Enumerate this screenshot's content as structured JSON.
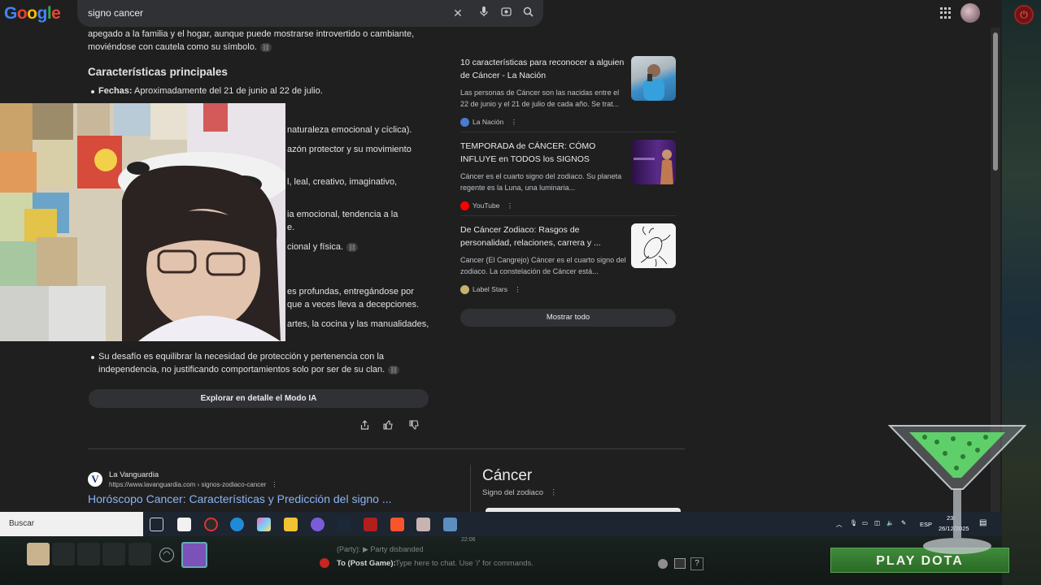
{
  "google": {
    "logo": "Google",
    "search_query": "signo cancer"
  },
  "overview": {
    "intro_line1": "apegado a la familia y el hogar, aunque puede mostrarse introvertido o cambiante,",
    "intro_line2": "moviéndose con cautela como su símbolo.",
    "heading": "Características principales",
    "fechas_label": "Fechas:",
    "fechas_value": "Aproximadamente del 21 de junio al 22 de julio.",
    "frag1": "naturaleza emocional y cíclica).",
    "frag2": "azón protector y su movimiento",
    "frag3": "l, leal, creativo, imaginativo,",
    "frag4": "ia emocional, tendencia a la",
    "frag4b": "e.",
    "frag5": "cional y física.",
    "frag6": "es profundas, entregándose por",
    "frag7": "que a veces lleva a decepciones.",
    "frag8": "artes, la cocina y las manualidades,",
    "last_bullet_line1": "Su desafío es equilibrar la necesidad de protección y pertenencia con la",
    "last_bullet_line2": "independencia, no justificando comportamientos solo por ser de su clan.",
    "ai_mode_button": "Explorar en detalle el Modo IA"
  },
  "sources": [
    {
      "title": "10 características para reconocer a alguien de Cáncer - La Nación",
      "snippet": "Las personas de Cáncer son las nacidas entre el 22 de junio y el 21 de julio de cada año. Se trat...",
      "site": "La Nación"
    },
    {
      "title": "TEMPORADA de CÁNCER: CÓMO INFLUYE en TODOS los SIGNOS",
      "snippet": "Cáncer es el cuarto signo del zodiaco. Su planeta regente es la Luna, una luminaria...",
      "site": "YouTube"
    },
    {
      "title": "De Cáncer Zodiaco: Rasgos de personalidad, relaciones, carrera y ...",
      "snippet": "Cancer (El Cangrejo) Cáncer es el cuarto signo del zodiaco. La constelación de Cáncer está...",
      "site": "Label Stars"
    }
  ],
  "show_all_button": "Mostrar todo",
  "result": {
    "favicon_letter": "V",
    "site_name": "La Vanguardia",
    "url": "https://www.lavanguardia.com › signos-zodiaco-cancer",
    "title": "Horóscopo Cancer: Características y Predicción del signo ..."
  },
  "knowledge_panel": {
    "title": "Cáncer",
    "subtitle": "Signo del zodiaco"
  },
  "taskbar": {
    "search_placeholder": "Buscar",
    "language": "ESP",
    "time": "23:",
    "date": "26/12/2025"
  },
  "game": {
    "clock": "22:06",
    "party_msg": "(Party): ▶ Party disbanded",
    "chat_target": "To (Post Game):",
    "chat_placeholder": "Type here to chat. Use '/' for commands.",
    "help": "?",
    "play_button": "PLAY DOTA"
  },
  "colors": {
    "page_bg": "#1f1f1f",
    "link_blue": "#8ab4f8",
    "play_green": "#2f7a2a"
  }
}
